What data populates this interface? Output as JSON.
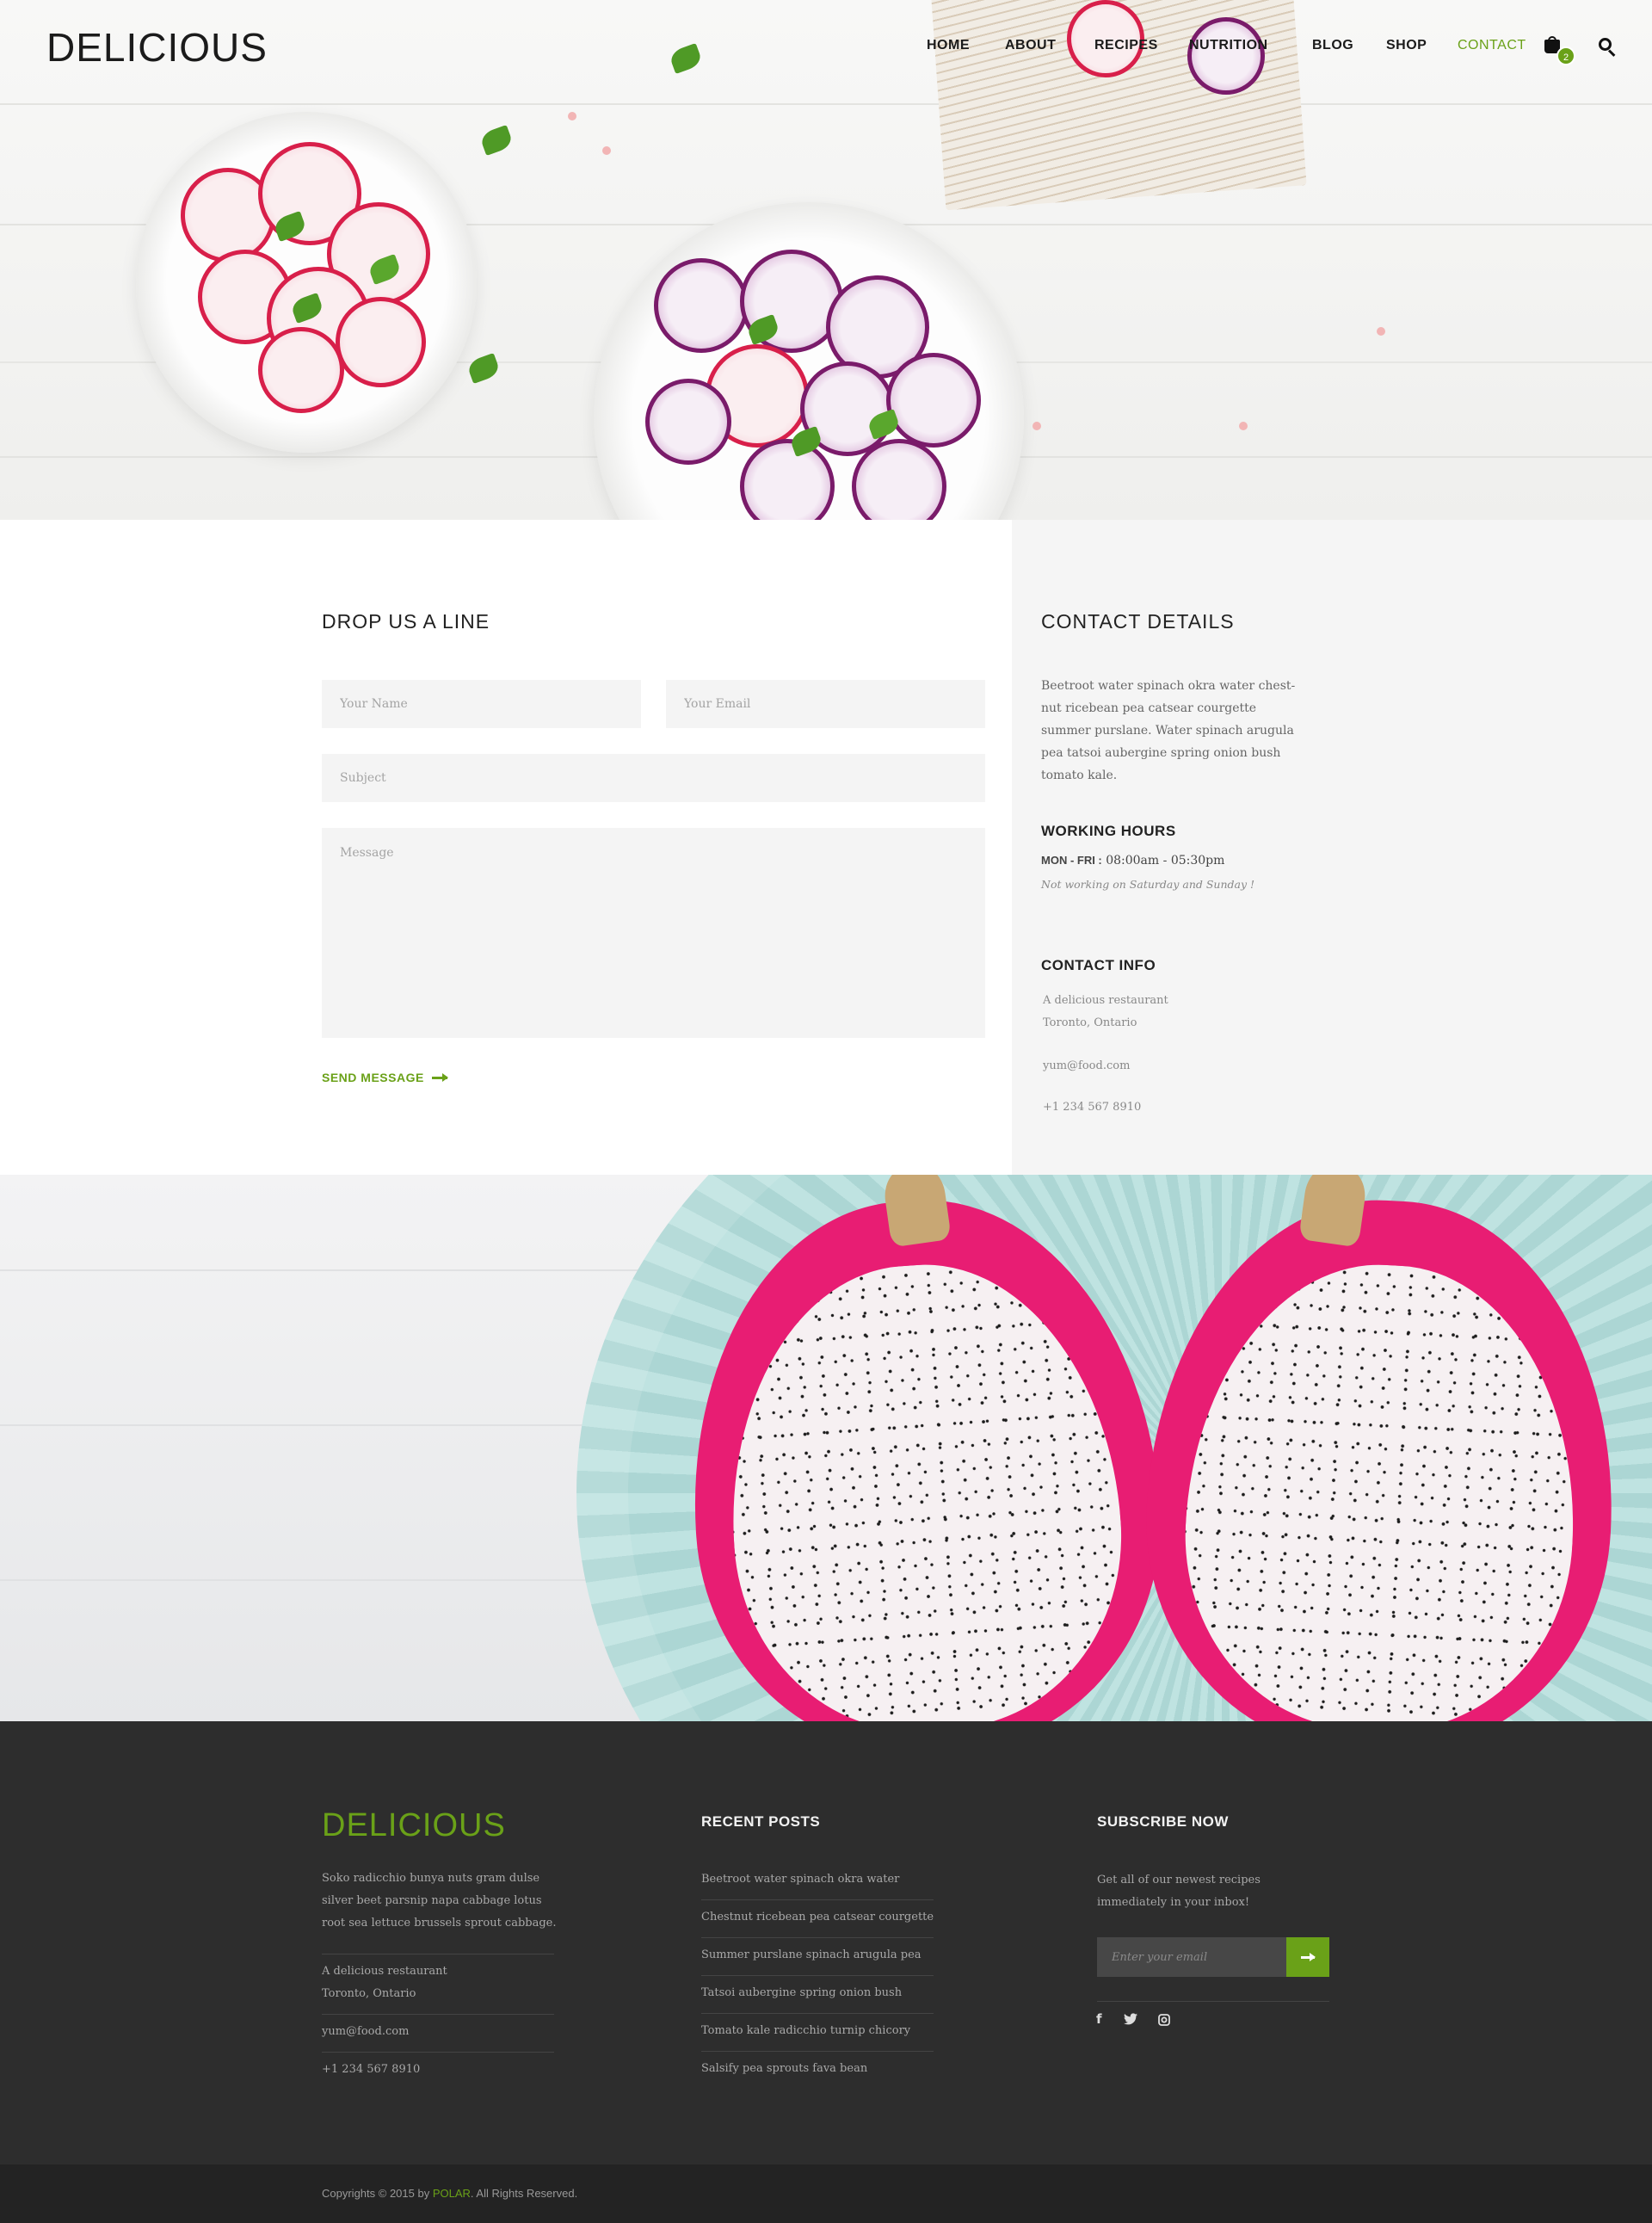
{
  "header": {
    "logo": "DELICIOUS",
    "nav": [
      "HOME",
      "ABOUT",
      "RECIPES",
      "NUTRITION",
      "BLOG",
      "SHOP",
      "CONTACT"
    ],
    "active_nav": "CONTACT",
    "cart_count": "2"
  },
  "form": {
    "title": "DROP US A LINE",
    "name_placeholder": "Your Name",
    "email_placeholder": "Your Email",
    "subject_placeholder": "Subject",
    "message_placeholder": "Message",
    "send_label": "SEND MESSAGE"
  },
  "details": {
    "title": "CONTACT DETAILS",
    "text": "Beetroot water spinach okra water chest-nut ricebean pea catsear courgette summer purslane. Water spinach arugula pea tatsoi aubergine spring onion bush tomato kale.",
    "hours_title": "WORKING HOURS",
    "hours_days": "MON - FRI :",
    "hours_time": " 08:00am - 05:30pm",
    "hours_note": "Not working on Saturday and Sunday !",
    "info_title": "CONTACT INFO",
    "address_line1": "A delicious restaurant",
    "address_line2": "Toronto, Ontario",
    "email": "yum@food.com",
    "phone": "+1 234 567 8910"
  },
  "footer": {
    "logo": "DELICIOUS",
    "about": "Soko radicchio bunya nuts gram dulse silver beet parsnip napa cabbage lotus root sea lettuce brussels sprout cabbage.",
    "address_line1": "A delicious restaurant",
    "address_line2": "Toronto, Ontario",
    "email": "yum@food.com",
    "phone": "+1 234 567 8910",
    "recent_title": "RECENT POSTS",
    "recent_posts": [
      "Beetroot water spinach okra water",
      "Chestnut ricebean pea catsear courgette",
      "Summer purslane spinach arugula pea",
      "Tatsoi aubergine spring onion bush",
      "Tomato kale radicchio turnip chicory",
      "Salsify pea sprouts fava bean"
    ],
    "subscribe_title": "SUBSCRIBE NOW",
    "subscribe_text": "Get all of our newest recipes immediately in your inbox!",
    "subscribe_placeholder": "Enter your email",
    "social_icons": [
      "facebook-icon",
      "twitter-icon",
      "instagram-icon"
    ]
  },
  "copyright": {
    "prefix": "Copyrights © 2015 by ",
    "brand": "POLAR",
    "suffix": ". All Rights Reserved."
  },
  "colors": {
    "accent": "#6aa118",
    "footer_bg": "#2d2d2d",
    "copybar_bg": "#232323"
  }
}
